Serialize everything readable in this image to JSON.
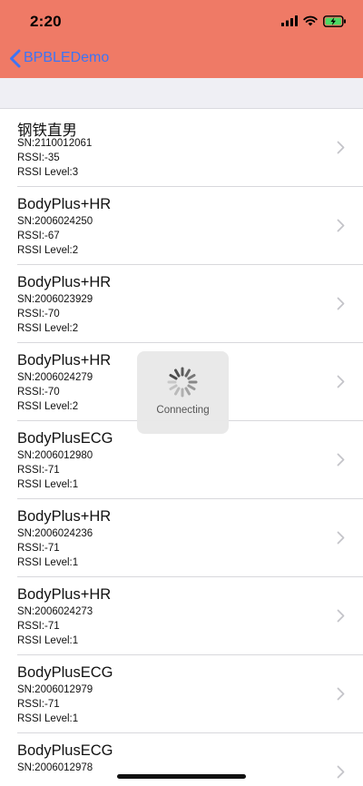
{
  "status_bar": {
    "time": "2:20",
    "icons": [
      "cellular-signal-icon",
      "wifi-icon",
      "battery-charging-icon"
    ]
  },
  "nav": {
    "back_label": "BPBLEDemo",
    "background_color": "#EF7A66",
    "accent_color": "#3D74F5"
  },
  "devices": [
    {
      "name": "钢铁直男",
      "sn": "SN:2110012061",
      "rssi": "RSSI:-35",
      "level": "RSSI Level:3"
    },
    {
      "name": "BodyPlus+HR",
      "sn": "SN:2006024250",
      "rssi": "RSSI:-67",
      "level": "RSSI Level:2"
    },
    {
      "name": "BodyPlus+HR",
      "sn": "SN:2006023929",
      "rssi": "RSSI:-70",
      "level": "RSSI Level:2"
    },
    {
      "name": "BodyPlus+HR",
      "sn": "SN:2006024279",
      "rssi": "RSSI:-70",
      "level": "RSSI Level:2"
    },
    {
      "name": "BodyPlusECG",
      "sn": "SN:2006012980",
      "rssi": "RSSI:-71",
      "level": "RSSI Level:1"
    },
    {
      "name": "BodyPlus+HR",
      "sn": "SN:2006024236",
      "rssi": "RSSI:-71",
      "level": "RSSI Level:1"
    },
    {
      "name": "BodyPlus+HR",
      "sn": "SN:2006024273",
      "rssi": "RSSI:-71",
      "level": "RSSI Level:1"
    },
    {
      "name": "BodyPlusECG",
      "sn": "SN:2006012979",
      "rssi": "RSSI:-71",
      "level": "RSSI Level:1"
    },
    {
      "name": "BodyPlusECG",
      "sn": "SN:2006012978",
      "rssi": "",
      "level": ""
    }
  ],
  "hud": {
    "label": "Connecting",
    "icon": "activity-spinner-icon"
  }
}
